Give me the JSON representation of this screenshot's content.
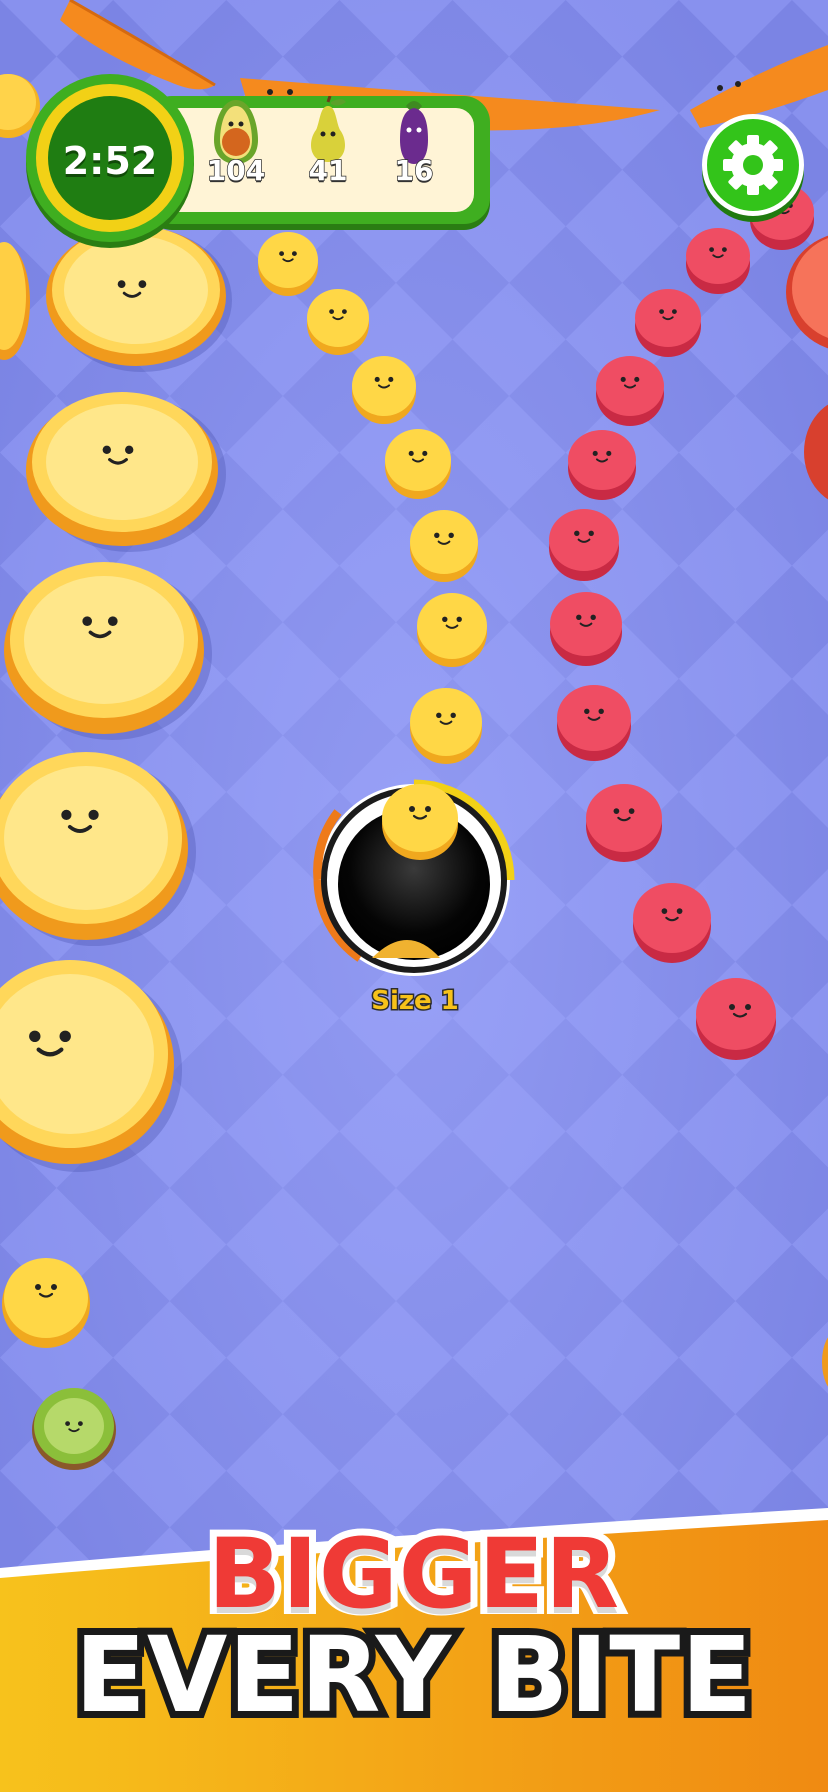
{
  "hud": {
    "timer": "2:52",
    "counters": [
      {
        "icon": "avocado-icon",
        "value": "104"
      },
      {
        "icon": "pear-icon",
        "value": "41"
      },
      {
        "icon": "eggplant-icon",
        "value": "16"
      }
    ]
  },
  "settings": {
    "icon": "gear-icon"
  },
  "player": {
    "size_label": "Size 1"
  },
  "banner": {
    "line1": "BIGGER",
    "line2": "EVERY BITE"
  },
  "colors": {
    "board_light": "#8e96f2",
    "board_dark": "#7780e2",
    "hud_green": "#3fae20",
    "timer_ring": "#f2d116",
    "banner_orange": "#f5a418",
    "banner_text_red": "#ef3a36"
  }
}
